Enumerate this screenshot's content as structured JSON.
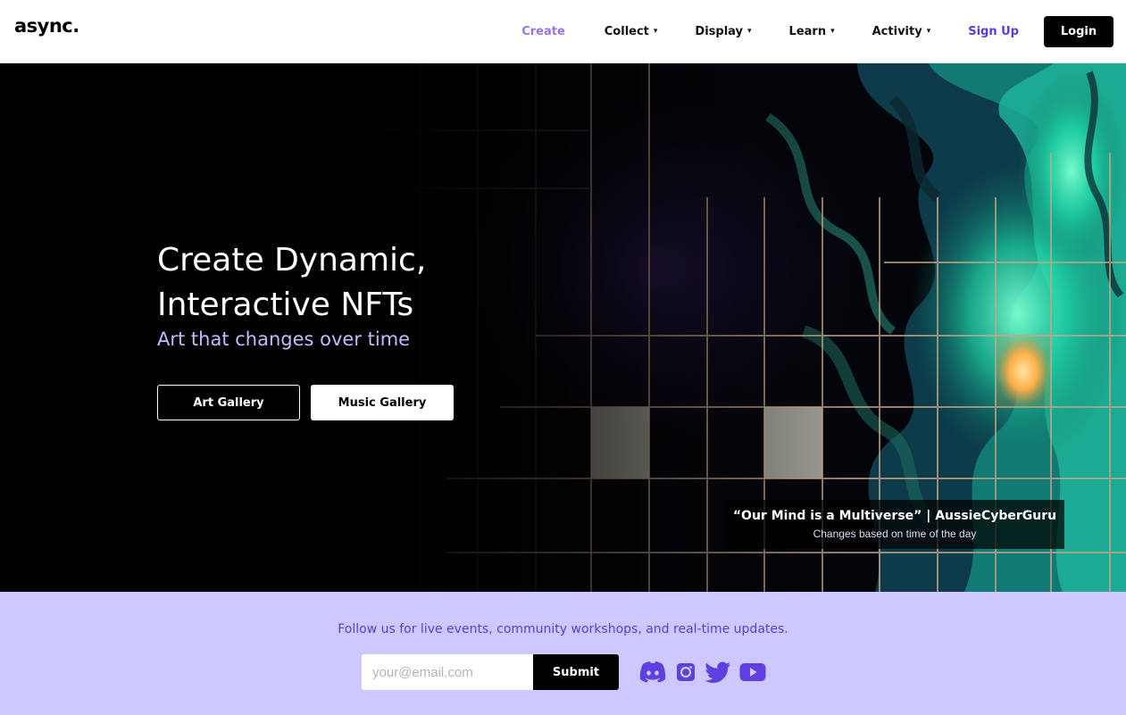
{
  "header": {
    "logo": "async.",
    "nav": {
      "create": "Create",
      "collect": "Collect",
      "display": "Display",
      "learn": "Learn",
      "activity": "Activity",
      "caret": "▾",
      "signup": "Sign Up",
      "login": "Login"
    }
  },
  "hero": {
    "title": "Create Dynamic, Interactive NFTs",
    "subtitle": "Art that changes over time",
    "art_gallery_label": "Art Gallery",
    "music_gallery_label": "Music Gallery",
    "caption_title": "“Our Mind is a Multiverse” | AussieCyberGuru",
    "caption_subtitle": "Changes based on time of the day"
  },
  "follow": {
    "text": "Follow us for live events, community workshops, and real-time updates.",
    "email_placeholder": "your@email.com",
    "email_value": "",
    "submit_label": "Submit",
    "social_icons": [
      "discord-icon",
      "instagram-icon",
      "twitter-icon",
      "youtube-icon"
    ]
  },
  "colors": {
    "accent_purple": "#9a72f0",
    "signup_purple": "#5b3be0",
    "follow_bg": "#cdc8ff",
    "follow_text": "#5540d6",
    "icon_purple": "#5f3fe0",
    "subtitle_lavender": "#c9b8ff"
  }
}
